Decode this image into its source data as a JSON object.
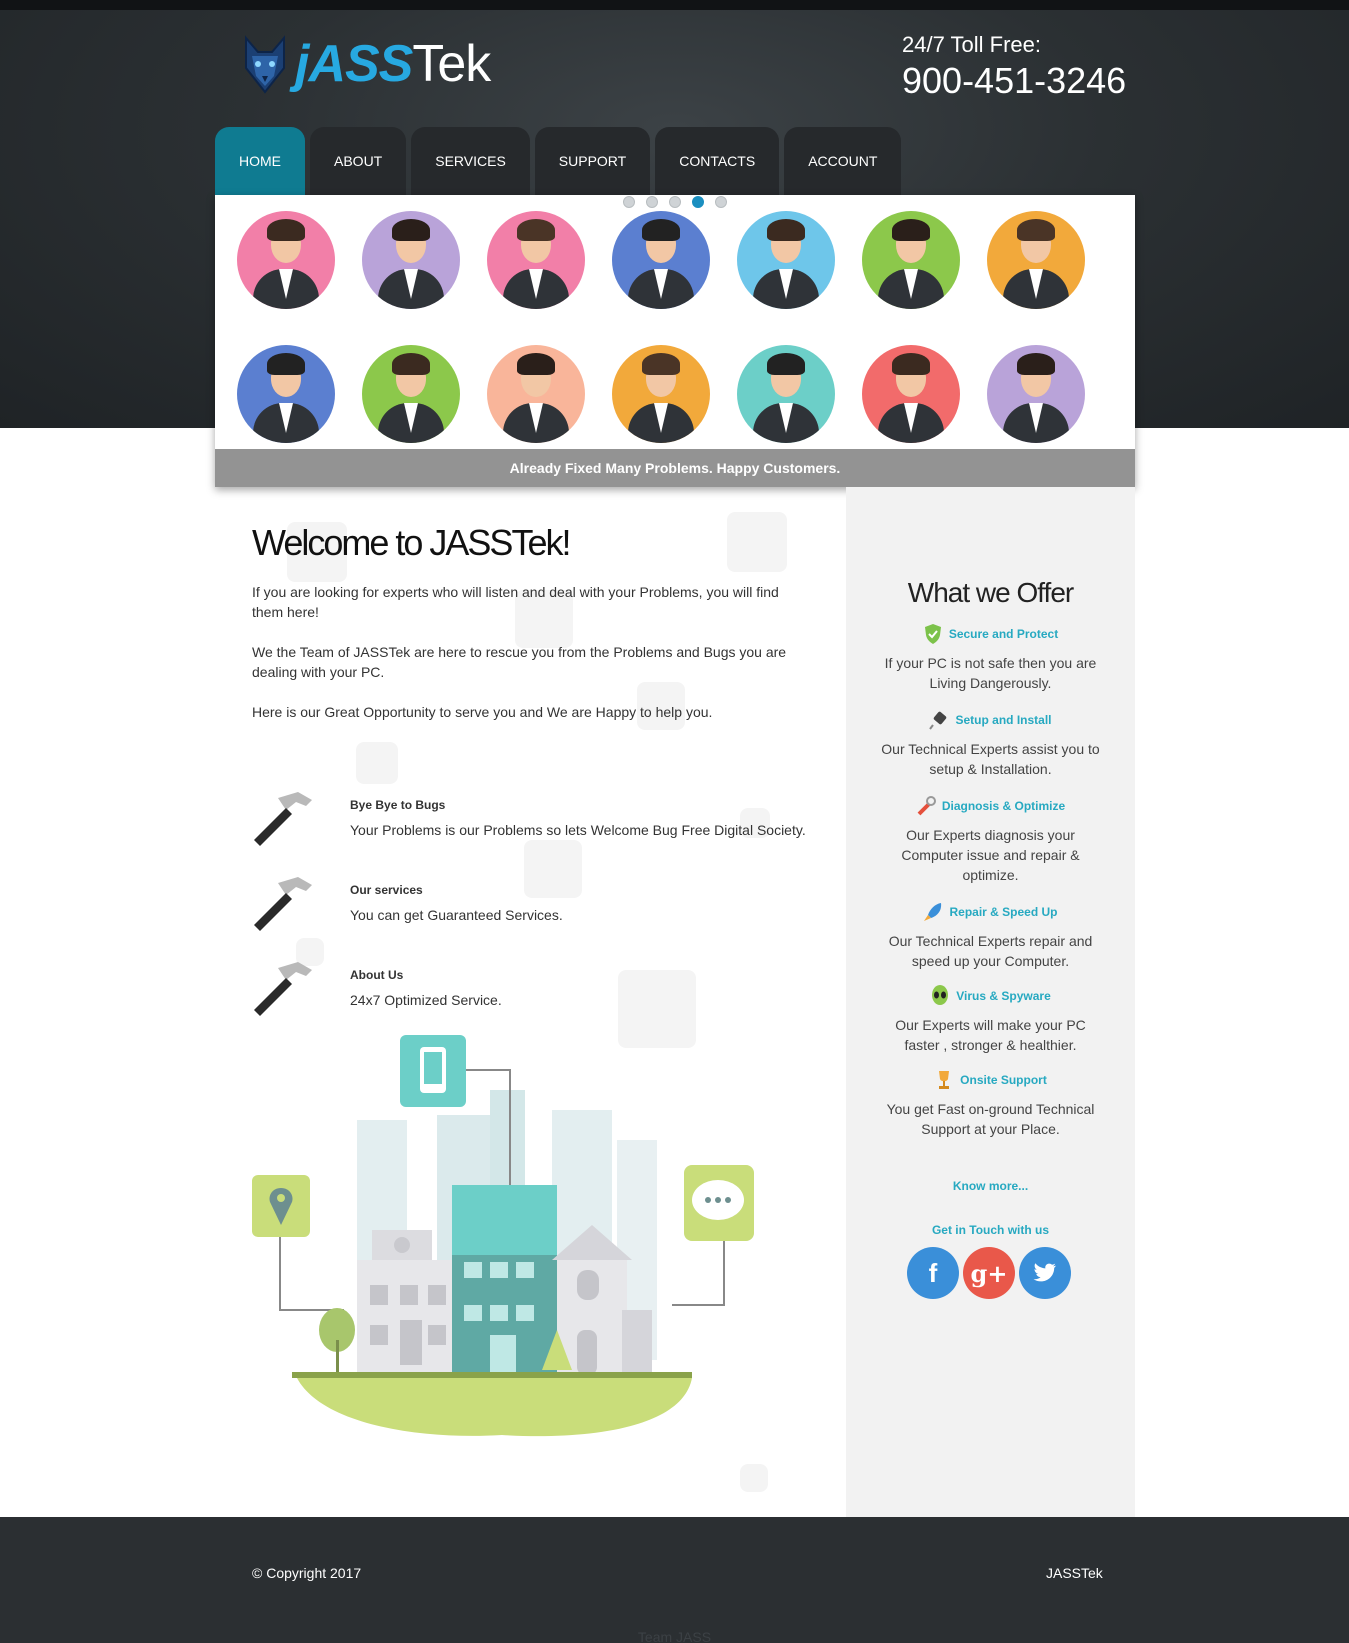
{
  "header": {
    "logo_text_main": "jASS",
    "logo_text_sub": "Tek",
    "phone_label": "24/7 Toll Free:",
    "phone_number": "900-451-3246"
  },
  "nav": {
    "items": [
      {
        "label": "HOME",
        "active": true
      },
      {
        "label": "ABOUT",
        "active": false
      },
      {
        "label": "SERVICES",
        "active": false
      },
      {
        "label": "SUPPORT",
        "active": false
      },
      {
        "label": "CONTACTS",
        "active": false
      },
      {
        "label": "ACCOUNT",
        "active": false
      }
    ]
  },
  "slider": {
    "caption": "Already Fixed Many Problems. Happy Customers.",
    "active_dot": 4,
    "dot_count": 5,
    "avatar_colors": [
      "#f27fa8",
      "#b9a3d9",
      "#f27fa8",
      "#5b7fd0",
      "#6ec6ea",
      "#8cc84b",
      "#f2a93b",
      "#5b7fd0",
      "#8cc84b",
      "#f9b59a",
      "#f2a93b",
      "#6ccfc8",
      "#f26b6b",
      "#b9a3d9"
    ]
  },
  "main": {
    "welcome_title": "Welcome to JASSTek!",
    "paragraphs": [
      "If you are looking for experts who will listen and deal with your Problems, you will find them here!",
      "We the Team of JASSTek are here to rescue you from the Problems and Bugs you are dealing with your PC.",
      "Here is our Great Opportunity to serve you and We are Happy to help you."
    ],
    "features": [
      {
        "title": "Bye Bye to Bugs",
        "desc": "Your Problems is our Problems so lets Welcome Bug Free Digital Society."
      },
      {
        "title": "Our services",
        "desc": "You can get Guaranteed Services."
      },
      {
        "title": "About Us",
        "desc": "24x7 Optimized Service."
      }
    ]
  },
  "sidebar": {
    "title": "What we Offer",
    "offers": [
      {
        "title": "Secure and Protect",
        "desc": "If your PC is not safe then you are Living Dangerously.",
        "icon": "shield-icon"
      },
      {
        "title": "Setup and Install",
        "desc": "Our Technical Experts assist you to setup & Installation.",
        "icon": "plug-icon"
      },
      {
        "title": "Diagnosis & Optimize",
        "desc": "Our Experts diagnosis your Computer issue and repair & optimize.",
        "icon": "wrench-icon"
      },
      {
        "title": "Repair & Speed Up",
        "desc": "Our Technical Experts repair and speed up your Computer.",
        "icon": "rocket-icon"
      },
      {
        "title": "Virus & Spyware",
        "desc": "Our Experts will make your PC faster , stronger & healthier.",
        "icon": "alien-icon"
      },
      {
        "title": "Onsite Support",
        "desc": "You get Fast on-ground Technical Support at your Place.",
        "icon": "trophy-icon"
      }
    ],
    "know_more": "Know more...",
    "get_in_touch": "Get in Touch with us",
    "social": {
      "facebook": "f",
      "googleplus": "g+",
      "twitter": "t"
    }
  },
  "footer": {
    "copyright": "© Copyright 2017",
    "brand": "JASSTek",
    "team": "Team JASS"
  },
  "colors": {
    "accent": "#27a9c1",
    "nav_active": "#0f7b91",
    "header_bg": "#2b3033",
    "footer_bg": "#2b2f32"
  }
}
